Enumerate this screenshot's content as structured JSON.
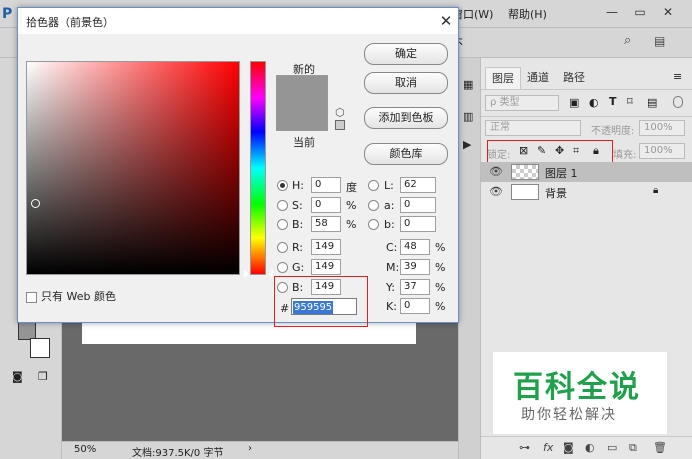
{
  "ps": {
    "menus": [
      "窗口(W)",
      "帮助(H)"
    ],
    "status": {
      "zoom": "50%",
      "doc": "文档:937.5K/0 字节"
    },
    "panel": {
      "tabs": [
        "图层",
        "通道",
        "路径"
      ],
      "filter_kind": "ρ 类型",
      "blend_mode": "正常",
      "opacity_label": "不透明度:",
      "opacity_value": "100%",
      "lock_label": "锁定:",
      "fill_label": "填充:",
      "fill_value": "100%",
      "layers": [
        {
          "name": "图层 1",
          "selected": true
        },
        {
          "name": "背景",
          "selected": false
        }
      ]
    },
    "watermark": {
      "title": "百科全说",
      "subtitle": "助你轻松解决"
    }
  },
  "dialog": {
    "title": "拾色器（前景色）",
    "new_label": "新的",
    "current_label": "当前",
    "swatch_color": "#959595",
    "buttons": {
      "ok": "确定",
      "cancel": "取消",
      "add_swatch": "添加到色板",
      "libraries": "颜色库"
    },
    "web_only": "只有 Web 颜色",
    "hsb": {
      "h": {
        "label": "H:",
        "value": "0",
        "unit": "度"
      },
      "s": {
        "label": "S:",
        "value": "0",
        "unit": "%"
      },
      "b": {
        "label": "B:",
        "value": "58",
        "unit": "%"
      }
    },
    "lab": {
      "l": {
        "label": "L:",
        "value": "62"
      },
      "a": {
        "label": "a:",
        "value": "0"
      },
      "b": {
        "label": "b:",
        "value": "0"
      }
    },
    "rgb": {
      "r": {
        "label": "R:",
        "value": "149"
      },
      "g": {
        "label": "G:",
        "value": "149"
      },
      "b": {
        "label": "B:",
        "value": "149"
      }
    },
    "cmyk": {
      "c": {
        "label": "C:",
        "value": "48",
        "unit": "%"
      },
      "m": {
        "label": "M:",
        "value": "39",
        "unit": "%"
      },
      "y": {
        "label": "Y:",
        "value": "37",
        "unit": "%"
      },
      "k": {
        "label": "K:",
        "value": "0",
        "unit": "%"
      }
    },
    "hex_label": "#",
    "hex_value": "959595"
  }
}
